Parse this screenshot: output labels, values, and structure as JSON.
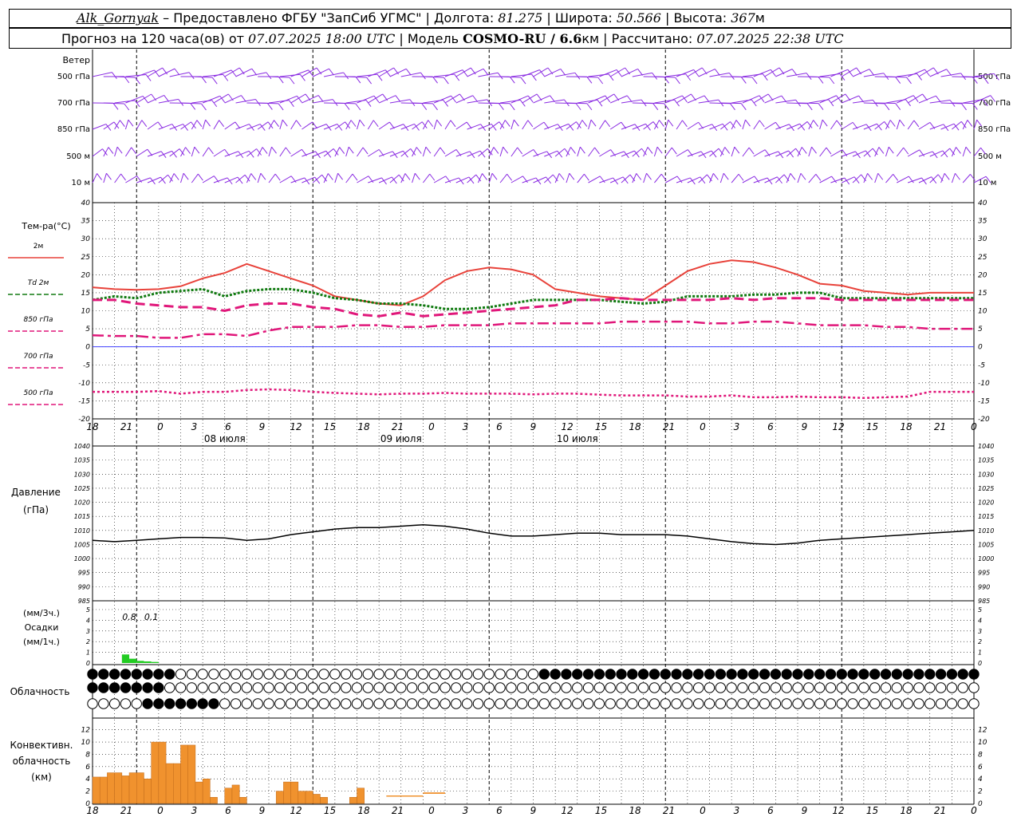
{
  "header": {
    "station": "Alk_Gornyak",
    "provider": " – Предоставлено ФГБУ \"ЗапСиб УГМС\" | Долгота: ",
    "lon": "81.275",
    "lat_label": " | Широта: ",
    "lat": "50.566",
    "alt_label": " | Высота: ",
    "alt": "367",
    "alt_unit": "м",
    "forecast_label": "Прогноз на 120 часа(ов) от ",
    "forecast_from": "07.07.2025 18:00 UTC",
    "model_label": " | Модель ",
    "model": "COSMO-RU / 6.6",
    "model_unit": "км",
    "calc_label": " | Рассчитано: ",
    "calc_time": "07.07.2025 22:38 UTC"
  },
  "labels": {
    "wind": "Ветер",
    "wind_levels": [
      "500 гПа",
      "700 гПа",
      "850 гПа",
      "500 м",
      "10 м"
    ],
    "temp_title": "Тем-ра(°C)",
    "temp_legend": [
      "2м",
      "Td 2м",
      "850 гПа",
      "700 гПа",
      "500 гПа"
    ],
    "pressure_title": [
      "Давление",
      "(гПа)"
    ],
    "precip_title": [
      "(мм/3ч.)",
      "Осадки",
      "(мм/1ч.)"
    ],
    "cloud_title": "Облачность",
    "conv_title": [
      "Конвективн.",
      "облачность",
      "(км)"
    ],
    "dates": [
      "08 июля",
      "09 июля",
      "10 июля"
    ],
    "x_ticks": [
      "18",
      "21",
      "0",
      "3",
      "6",
      "9",
      "12",
      "15",
      "18",
      "21",
      "0",
      "3",
      "6",
      "9",
      "12",
      "15",
      "18",
      "21",
      "0",
      "3",
      "6",
      "9",
      "12",
      "15",
      "18",
      "21",
      "0"
    ],
    "precip_annotations": [
      "0.8",
      "0.1"
    ]
  },
  "colors": {
    "wind": "#8a2be2",
    "t2m": "#e8423a",
    "td2m": "#107a10",
    "t850": "#e0177a",
    "t700": "#e0177a",
    "t500": "#e0177a",
    "zero_line": "#4040ff",
    "pressure": "#000000",
    "precip": "#22cc22",
    "conv": "#f0922e"
  },
  "chart_data": [
    {
      "type": "line",
      "title": "Тем-ра(°C)",
      "x_hours": [
        0,
        3,
        6,
        9,
        12,
        15,
        18,
        21,
        24,
        27,
        30,
        33,
        36,
        39,
        42,
        45,
        48,
        51,
        54,
        57,
        60,
        63,
        66,
        69,
        72,
        75,
        78,
        81,
        84,
        87,
        90,
        93,
        96,
        99,
        102,
        105,
        108,
        111,
        114,
        117,
        120
      ],
      "ylim": [
        -20,
        40
      ],
      "series": [
        {
          "name": "2м",
          "values": [
            16.5,
            16.0,
            15.8,
            16.0,
            16.8,
            19.0,
            20.5,
            23.0,
            21.0,
            19.0,
            17.0,
            14.0,
            13.0,
            12.0,
            11.5,
            14.0,
            18.5,
            21.0,
            22.0,
            21.5,
            20.0,
            16.0,
            15.0,
            14.0,
            13.5,
            13.0,
            17.0,
            21.0,
            23.0,
            24.0,
            23.5,
            22.0,
            20.0,
            17.5,
            17.0,
            15.5,
            15.0,
            14.5,
            15.0,
            15.0,
            15.0
          ]
        },
        {
          "name": "Td 2м",
          "values": [
            13.0,
            14.0,
            13.5,
            15.0,
            15.5,
            16.0,
            14.0,
            15.5,
            16.0,
            16.0,
            15.0,
            13.5,
            13.0,
            12.0,
            12.0,
            11.5,
            10.5,
            10.5,
            11.0,
            12.0,
            13.0,
            13.0,
            13.0,
            13.0,
            12.5,
            12.0,
            12.5,
            14.0,
            14.0,
            14.0,
            14.5,
            14.5,
            15.0,
            15.0,
            13.5,
            13.5,
            13.5,
            13.5,
            13.5,
            13.5,
            13.5
          ]
        },
        {
          "name": "850 гПа",
          "values": [
            13.0,
            13.0,
            12.0,
            11.5,
            11.0,
            11.0,
            10.0,
            11.5,
            12.0,
            12.0,
            11.0,
            10.5,
            9.0,
            8.5,
            9.5,
            8.5,
            9.0,
            9.5,
            10.0,
            10.5,
            11.0,
            11.5,
            13.0,
            13.0,
            13.5,
            13.0,
            13.0,
            13.0,
            13.0,
            13.5,
            13.0,
            13.5,
            13.5,
            13.5,
            13.0,
            13.0,
            13.0,
            13.0,
            13.0,
            13.0,
            13.0
          ]
        },
        {
          "name": "700 гПа",
          "values": [
            3.2,
            3.0,
            3.0,
            2.5,
            2.5,
            3.5,
            3.5,
            3.0,
            4.5,
            5.5,
            5.5,
            5.5,
            6.0,
            6.0,
            5.5,
            5.5,
            6.0,
            6.0,
            6.0,
            6.5,
            6.5,
            6.5,
            6.5,
            6.5,
            7.0,
            7.0,
            7.0,
            7.0,
            6.5,
            6.5,
            7.0,
            7.0,
            6.5,
            6.0,
            6.0,
            6.0,
            5.5,
            5.5,
            5.0,
            5.0,
            5.0
          ]
        },
        {
          "name": "500 гПа",
          "values": [
            -12.5,
            -12.5,
            -12.5,
            -12.3,
            -13.0,
            -12.5,
            -12.5,
            -12.0,
            -11.8,
            -12.0,
            -12.5,
            -12.8,
            -13.0,
            -13.2,
            -13.0,
            -13.0,
            -12.8,
            -13.0,
            -13.0,
            -13.0,
            -13.2,
            -13.0,
            -13.0,
            -13.3,
            -13.5,
            -13.5,
            -13.5,
            -13.8,
            -13.8,
            -13.5,
            -14.0,
            -14.0,
            -13.8,
            -14.0,
            -14.0,
            -14.2,
            -14.0,
            -13.8,
            -12.5,
            -12.5,
            -12.5
          ]
        }
      ]
    },
    {
      "type": "line",
      "title": "Давление",
      "ylim": [
        985,
        1040
      ],
      "x_hours": [
        0,
        3,
        6,
        9,
        12,
        15,
        18,
        21,
        24,
        27,
        30,
        33,
        36,
        39,
        42,
        45,
        48,
        51,
        54,
        57,
        60,
        63,
        66,
        69,
        72,
        75,
        78,
        81,
        84,
        87,
        90,
        93,
        96,
        99,
        102,
        105,
        108,
        111,
        114,
        117,
        120
      ],
      "series": [
        {
          "name": "Давление",
          "values": [
            1006.5,
            1006.0,
            1006.5,
            1007.0,
            1007.5,
            1007.5,
            1007.3,
            1006.5,
            1007.0,
            1008.5,
            1009.5,
            1010.5,
            1011.0,
            1011.0,
            1011.5,
            1012.0,
            1011.5,
            1010.5,
            1009.0,
            1008.0,
            1008.0,
            1008.5,
            1009.0,
            1009.0,
            1008.5,
            1008.5,
            1008.5,
            1008.0,
            1007.0,
            1006.0,
            1005.3,
            1005.0,
            1005.5,
            1006.5,
            1007.0,
            1007.5,
            1008.0,
            1008.5,
            1009.0,
            1009.5,
            1010.0
          ]
        }
      ]
    },
    {
      "type": "bar",
      "title": "Осадки",
      "ylim": [
        0,
        5
      ],
      "x_hours": [
        4,
        5,
        6,
        7,
        8
      ],
      "values": [
        0.8,
        0.4,
        0.2,
        0.15,
        0.1
      ]
    },
    {
      "type": "bar",
      "title": "Конвективн. облачность",
      "ylim": [
        0,
        13
      ],
      "x_hours": [
        0,
        1,
        2,
        3,
        4,
        5,
        6,
        7,
        8,
        9,
        10,
        11,
        12,
        13,
        14,
        15,
        16,
        17,
        18,
        19,
        20,
        21,
        22,
        23,
        24,
        25,
        26,
        27,
        28,
        29,
        30,
        31,
        32,
        33,
        34,
        35,
        36,
        37,
        38,
        39,
        40,
        41,
        42,
        43,
        44,
        45,
        46,
        47,
        48,
        49,
        50,
        51,
        52,
        53
      ],
      "values": [
        4.3,
        4.3,
        5.0,
        5.0,
        4.5,
        5.0,
        5.0,
        4.0,
        10.0,
        10.0,
        6.5,
        6.5,
        9.5,
        9.5,
        3.5,
        4.0,
        1.0,
        0.0,
        2.5,
        3.0,
        1.0,
        0.0,
        0.0,
        0.0,
        0.0,
        2.0,
        3.5,
        3.5,
        2.0,
        2.0,
        1.5,
        1.0,
        0.0,
        0.0,
        0.0,
        1.0,
        2.5,
        0.0,
        0.0,
        0.0,
        0.0,
        0.0,
        0.0,
        0.0,
        0.0,
        0.0,
        0.0,
        0.0,
        0.0,
        0.0,
        0.0,
        0.0,
        0.0,
        0.0
      ]
    }
  ]
}
